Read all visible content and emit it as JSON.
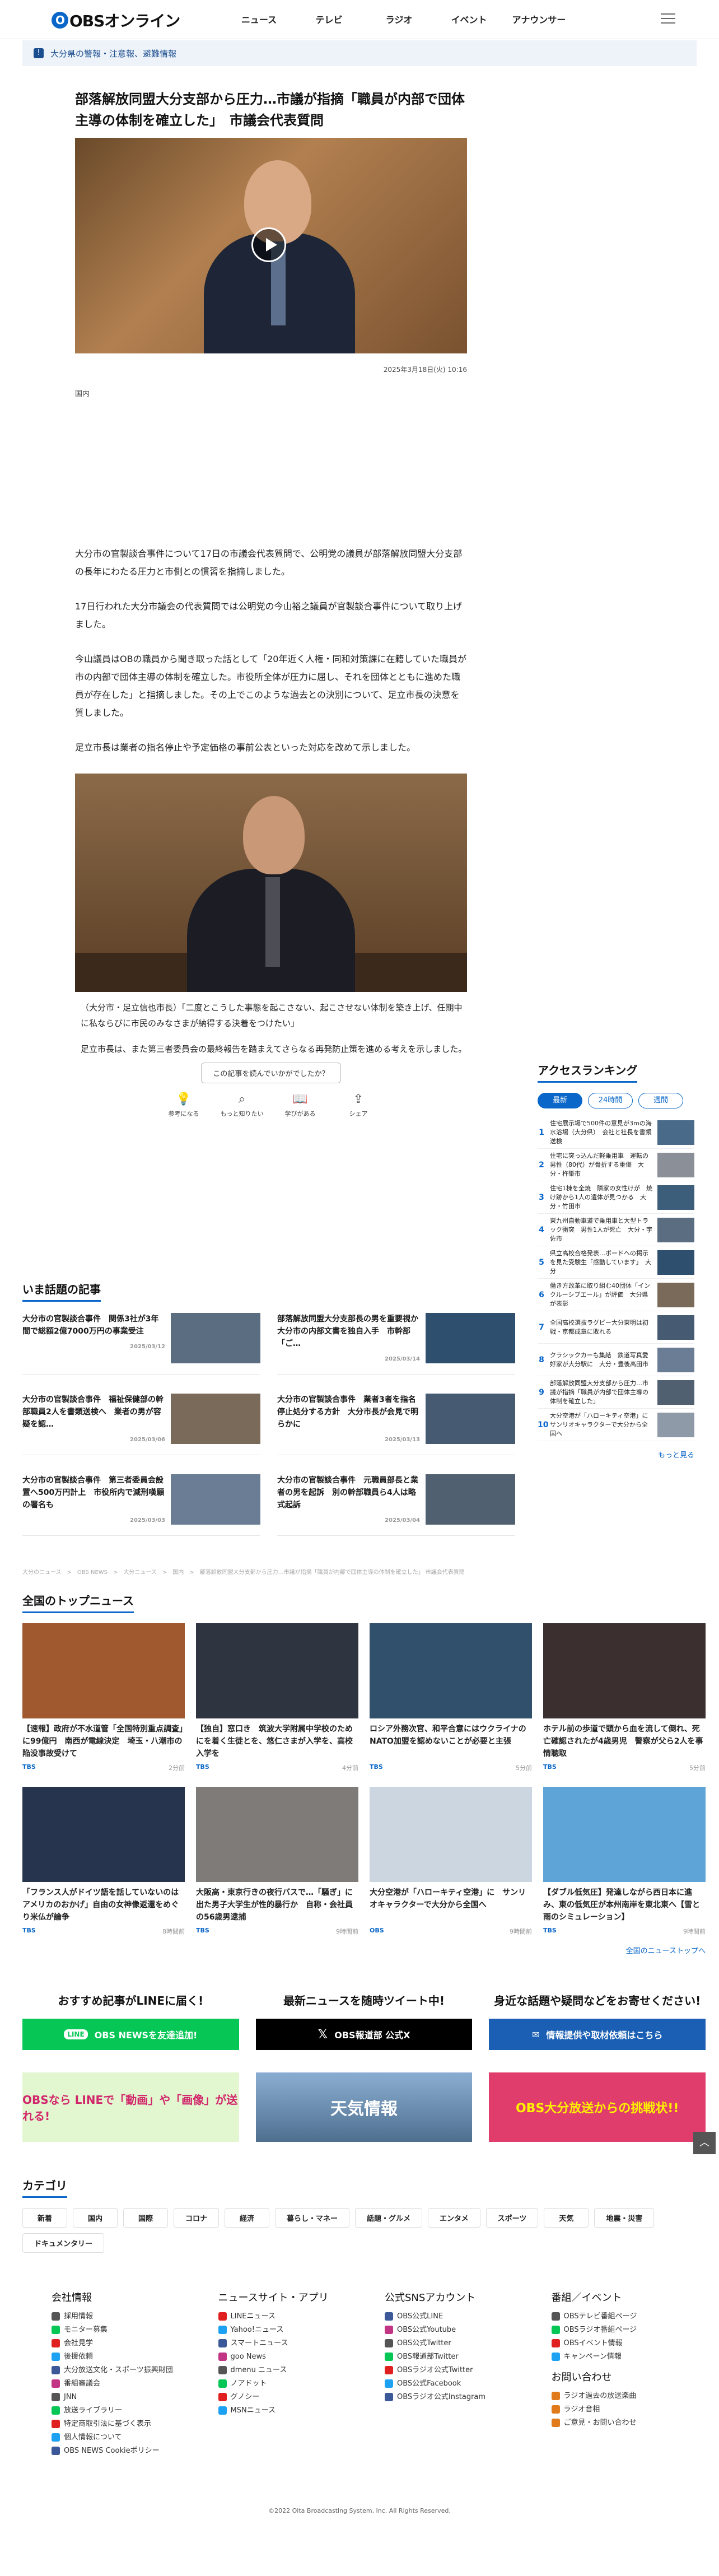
{
  "header": {
    "logo": "OBSオンライン",
    "logo_mark": "O",
    "nav": [
      "ニュース",
      "テレビ",
      "ラジオ",
      "イベント",
      "アナウンサー"
    ]
  },
  "alert": {
    "text": "大分県の警報・注意報、避難情報"
  },
  "article": {
    "title": "部落解放同盟大分支部から圧力…市議が指摘「職員が内部で団体主導の体制を確立した」　市議会代表質問",
    "date": "2025年3月18日(火) 10:16",
    "category": "国内",
    "paragraphs": [
      "大分市の官製談合事件について17日の市議会代表質問で、公明党の議員が部落解放同盟大分支部の長年にわたる圧力と市側との慣習を指摘しました。",
      "17日行われた大分市議会の代表質問では公明党の今山裕之議員が官製談合事件について取り上げました。",
      "今山議員はOBの職員から聞き取った話として「20年近く人権・同和対策課に在籍していた職員が市の内部で団体主導の体制を確立した。市役所全体が圧力に屈し、それを団体とともに進めた職員が存在した」と指摘しました。その上でこのような過去との決別について、足立市長の決意を質しました。",
      "足立市長は業者の指名停止や予定価格の事前公表といった対応を改めて示しました。"
    ],
    "caption": "（大分市・足立信也市長）「二度とこうした事態を起こさない、起こさせない体制を築き上げ、任期中に私ならびに市民のみなさまが納得する決着をつけたい」",
    "closing": "足立市長は、また第三者委員会の最終報告を踏まえてさらなる再発防止策を進める考えを示しました。"
  },
  "feedback": {
    "question": "この記事を読んでいかがでしたか？",
    "options": [
      "参考になる",
      "もっと知りたい",
      "学びがある",
      "シェア"
    ]
  },
  "hot": {
    "title": "いま話題の記事",
    "items": [
      {
        "text": "大分市の官製談合事件　関係3社が3年間で総額2億7000万円の事業受注",
        "date": "2025/03/12"
      },
      {
        "text": "部落解放同盟大分支部長の男を重要視か　大分市の内部文書を独自入手　市幹部「ご…",
        "date": "2025/03/14"
      },
      {
        "text": "大分市の官製談合事件　福祉保健部の幹部職員2人を書類送検へ　業者の男が容疑を認…",
        "date": "2025/03/06"
      },
      {
        "text": "大分市の官製談合事件　業者3者を指名停止処分する方針　大分市長が会見で明らかに",
        "date": "2025/03/13"
      },
      {
        "text": "大分市の官製談合事件　第三者委員会設置へ500万円計上　市役所内で減刑嘆願の署名も",
        "date": "2025/03/03"
      },
      {
        "text": "大分市の官製談合事件　元職員部長と業者の男を起訴　別の幹部職員ら4人は略式起訴",
        "date": "2025/03/04"
      }
    ]
  },
  "breadcrumb": "大分のニュース　>　OBS NEWS　>　大分ニュース　>　国内　>　部落解放同盟大分支部から圧力…市議が指摘「職員が内部で団体主導の体制を確立した」 市議会代表質問",
  "ranking": {
    "title": "アクセスランキング",
    "tabs": [
      "最新",
      "24時間",
      "週間"
    ],
    "items": [
      "住宅展示場で500件の意見が3mの海水浴場（大分県）　会社と社長を書類送検",
      "住宅に突っ込んだ軽乗用車　運転の男性（80代）が骨折する重傷　大分・杵築市",
      "住宅1棟を全焼　隣家の女性けが　焼け跡から1人の遺体が見つかる　大分・竹田市",
      "東九州自動車道で乗用車と大型トラック衝突　男性1人が死亡　大分・宇佐市",
      "県立高校合格発表…ボードへの掲示を見た受験生「感動しています」　大分",
      "働き方改革に取り組む40団体「インクルーシブエール」が評価　大分県が表彰",
      "全国高校選抜ラグビー大分東明は初戦・京都成章に敗れる",
      "クラシックカーも集結　鉄道写真愛好家が大分駅に　大分・豊後高田市",
      "部落解放同盟大分支部から圧力…市議が指摘「職員が内部で団体主導の体制を確立した」",
      "大分空港が「ハローキティ空港」に　サンリオキャラクターで大分から全国へ"
    ],
    "more": "もっと見る"
  },
  "top_news": {
    "title": "全国のトップニュース",
    "items": [
      {
        "text": "【速報】政府が不水道管「全国特別重点調査」に99億円　南西が電線決定　埼玉・八潮市の陥没事故受けて",
        "source": "TBS",
        "date": "2分前"
      },
      {
        "text": "【独自】窓口き　筑波大学附属中学校のためにを着く生徒とを、悠仁さまが入学を、高校入学を",
        "source": "TBS",
        "date": "4分前"
      },
      {
        "text": "ロシア外務次官、和平合意にはウクライナのNATO加盟を認めないことが必要と主張",
        "source": "TBS",
        "date": "5分前"
      },
      {
        "text": "ホテル前の歩道で頭から血を流して倒れ、死亡確認されたが4歳男児　警察が父ら2人を事情聴取",
        "source": "TBS",
        "date": "5分前"
      },
      {
        "text": "「フランス人がドイツ語を話していないのはアメリカのおかげ」自由の女神像返還をめぐり米仏が論争",
        "source": "TBS",
        "date": "8時間前"
      },
      {
        "text": "大阪高・東京行きの夜行バスで…「騒ぎ」に出た男子大学生が性的暴行か　自称・会社員の56歳男逮捕",
        "source": "TBS",
        "date": "9時間前"
      },
      {
        "text": "大分空港が「ハローキティ空港」に　サンリオキャラクターで大分から全国へ",
        "source": "OBS",
        "date": "9時間前"
      },
      {
        "text": "【ダブル低気圧】発達しながら西日本に進み、東の低気圧が本州南岸を東北東へ【雪と雨のシミュレーション】",
        "source": "TBS",
        "date": "9時間前"
      }
    ],
    "more": "全国のニューストップへ"
  },
  "promo": [
    {
      "heading": "おすすめ記事がLINEに届く!",
      "button": "OBS NEWSを友達追加!",
      "color": "#06c755"
    },
    {
      "heading": "最新ニュースを随時ツイート中!",
      "button": "OBS報道部 公式X",
      "color": "#000000"
    },
    {
      "heading": "身近な話題や疑問などをお寄せください!",
      "button": "情報提供や取材依頼はこちら",
      "color": "#1a5fb4"
    }
  ],
  "banners": [
    {
      "text": "OBSなら LINEで「動画」や「画像」が送れる!",
      "color": "#e2f7cf"
    },
    {
      "text": "天気情報",
      "color": "#5a7fa6"
    },
    {
      "text": "OBS大分放送からの挑戦状!!",
      "color": "#e03c6c"
    }
  ],
  "categories": {
    "title": "カテゴリ",
    "items": [
      "新着",
      "国内",
      "国際",
      "コロナ",
      "経済",
      "暮らし・マネー",
      "話題・グルメ",
      "エンタメ",
      "スポーツ",
      "天気",
      "地震・災害",
      "ドキュメンタリー"
    ]
  },
  "footer": [
    {
      "title": "会社情報",
      "items": [
        "採用情報",
        "モニター募集",
        "会社見学",
        "後援依頼",
        "大分放送文化・スポーツ振興財団",
        "番組審議会",
        "JNN",
        "放送ライブラリー",
        "特定商取引法に基づく表示",
        "個人情報について",
        "OBS NEWS Cookieポリシー"
      ]
    },
    {
      "title": "ニュースサイト・アプリ",
      "items": [
        "LINEニュース",
        "Yahoo!ニュース",
        "スマートニュース",
        "goo News",
        "dmenu ニュース",
        "ノアドット",
        "グノシー",
        "MSNニュース"
      ]
    },
    {
      "title": "公式SNSアカウント",
      "items": [
        "OBS公式LINE",
        "OBS公式Youtube",
        "OBS公式Twitter",
        "OBS報道部Twitter",
        "OBSラジオ公式Twitter",
        "OBS公式Facebook",
        "OBSラジオ公式Instagram"
      ]
    },
    {
      "title": "番組／イベント",
      "items": [
        "OBSテレビ番組ページ",
        "OBSラジオ番組ページ",
        "OBSイベント情報",
        "キャンペーン情報"
      ],
      "title2": "お問い合わせ",
      "items2": [
        "ラジオ過去の放送楽曲",
        "ラジオ音相",
        "ご意見・お問い合わせ"
      ]
    }
  ],
  "copyright": "©2022 Oita Broadcasting System, Inc. All Rights Reserved.",
  "colors": {
    "brand": "#0a67c9",
    "line": "#06c755",
    "x": "#000000"
  }
}
